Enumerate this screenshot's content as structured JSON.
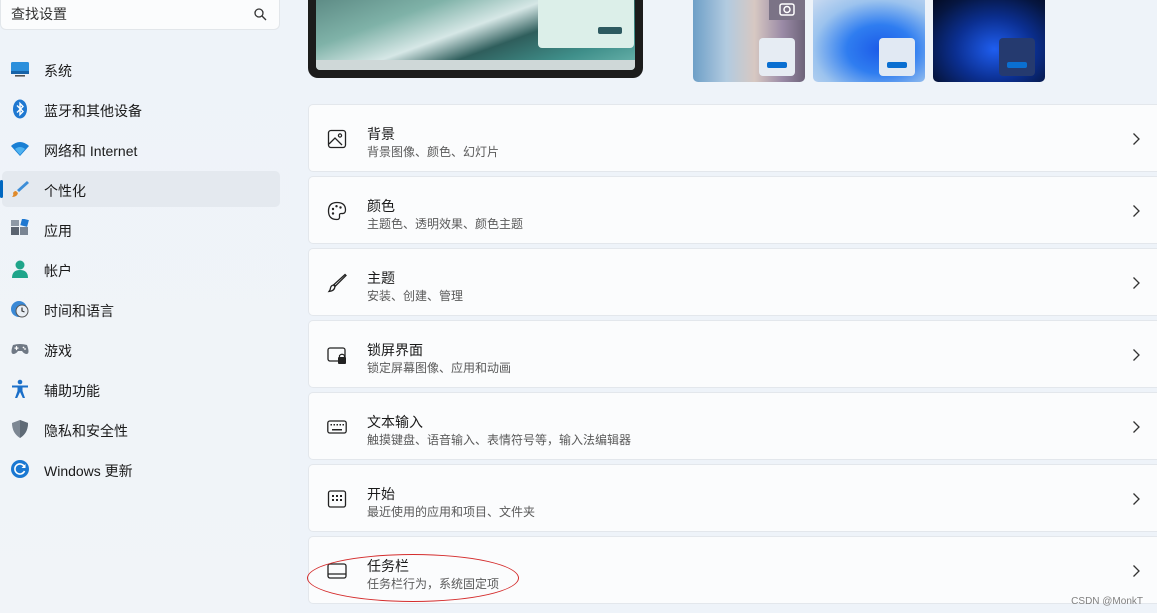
{
  "search": {
    "placeholder": "查找设置"
  },
  "sidebar": {
    "items": [
      {
        "label": "系统"
      },
      {
        "label": "蓝牙和其他设备"
      },
      {
        "label": "网络和 Internet"
      },
      {
        "label": "个性化",
        "active": true
      },
      {
        "label": "应用"
      },
      {
        "label": "帐户"
      },
      {
        "label": "时间和语言"
      },
      {
        "label": "游戏"
      },
      {
        "label": "辅助功能"
      },
      {
        "label": "隐私和安全性"
      },
      {
        "label": "Windows 更新"
      }
    ]
  },
  "cards": [
    {
      "title": "背景",
      "sub": "背景图像、颜色、幻灯片",
      "icon": "image-icon"
    },
    {
      "title": "颜色",
      "sub": "主题色、透明效果、颜色主题",
      "icon": "palette-icon"
    },
    {
      "title": "主题",
      "sub": "安装、创建、管理",
      "icon": "brush-icon"
    },
    {
      "title": "锁屏界面",
      "sub": "锁定屏幕图像、应用和动画",
      "icon": "lock-screen-icon"
    },
    {
      "title": "文本输入",
      "sub": "触摸键盘、语音输入、表情符号等，输入法编辑器",
      "icon": "keyboard-icon"
    },
    {
      "title": "开始",
      "sub": "最近使用的应用和项目、文件夹",
      "icon": "start-icon"
    },
    {
      "title": "任务栏",
      "sub": "任务栏行为，系统固定项",
      "icon": "taskbar-icon"
    }
  ],
  "colors": {
    "accent": "#0067c0",
    "annotation": "#d42c2c"
  },
  "watermark": "CSDN @MonkT"
}
